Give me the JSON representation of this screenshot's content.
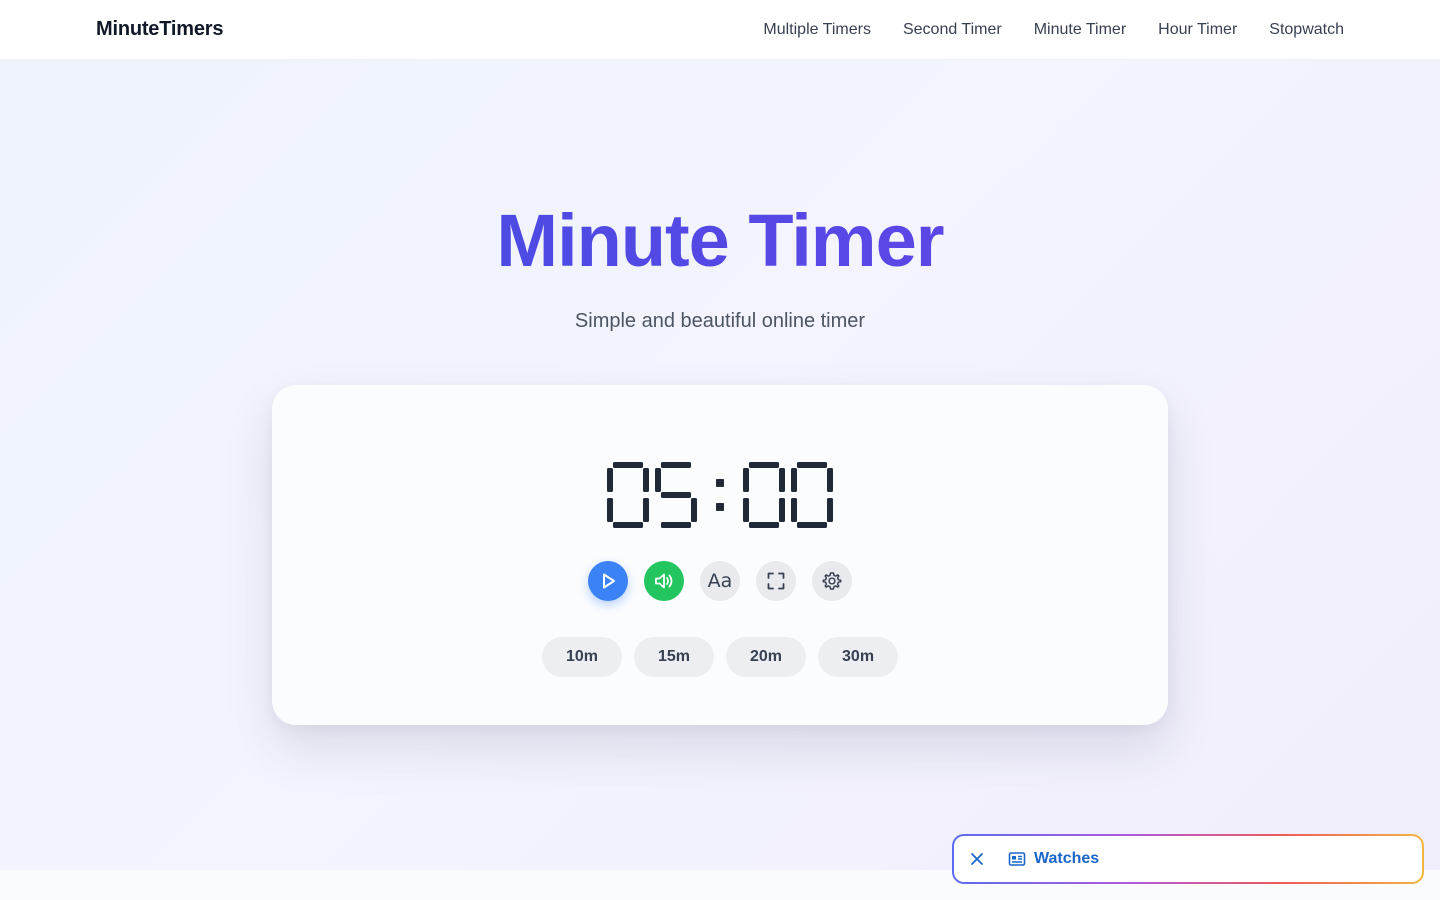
{
  "header": {
    "brand": "MinuteTimers",
    "nav": [
      "Multiple Timers",
      "Second Timer",
      "Minute Timer",
      "Hour Timer",
      "Stopwatch"
    ]
  },
  "hero": {
    "title": "Minute Timer",
    "subtitle": "Simple and beautiful online timer"
  },
  "timer": {
    "display": "05:00",
    "minutes": "05",
    "seconds": "00",
    "controls": [
      "play-icon",
      "volume-icon",
      "font-icon",
      "fullscreen-icon",
      "gear-icon"
    ],
    "font_button_label": "Aa",
    "presets": [
      "10m",
      "15m",
      "20m",
      "30m"
    ]
  },
  "watches_bar": {
    "label": "Watches"
  },
  "colors": {
    "title_gradient_start": "#3f4fe0",
    "title_gradient_end": "#6a42ea",
    "play": "#3b82f6",
    "sound": "#22c55e",
    "link_blue": "#1a66c9"
  }
}
